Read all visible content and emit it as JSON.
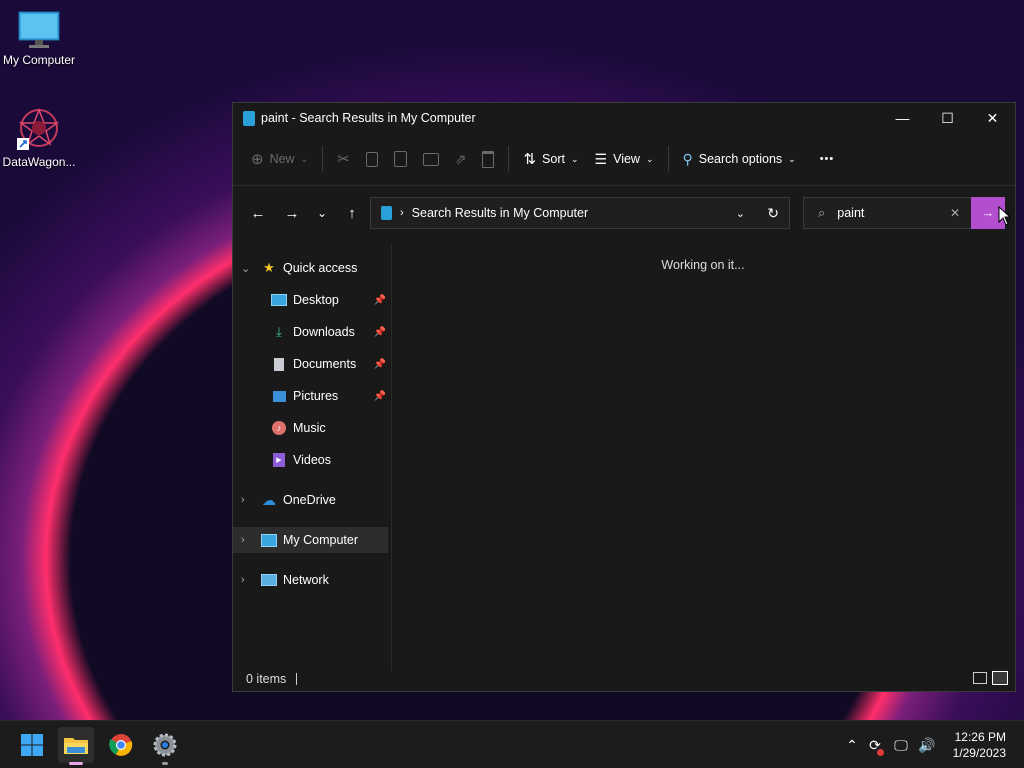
{
  "desktop": {
    "icons": [
      {
        "label": "My Computer",
        "icon": "monitor-icon"
      },
      {
        "label": "DataWagon...",
        "icon": "datawagon-shortcut-icon"
      }
    ]
  },
  "window": {
    "title": "paint - Search Results in My Computer",
    "controls": {
      "minimize": "—",
      "maximize": "☐",
      "close": "✕"
    }
  },
  "toolbar": {
    "new_label": "New",
    "sort_label": "Sort",
    "view_label": "View",
    "search_options_label": "Search options",
    "more_label": "•••"
  },
  "address_bar": {
    "path": "Search Results in My Computer"
  },
  "search": {
    "value": "paint"
  },
  "nav_pane": {
    "quick_access": "Quick access",
    "items": [
      {
        "label": "Desktop",
        "pinned": true
      },
      {
        "label": "Downloads",
        "pinned": true
      },
      {
        "label": "Documents",
        "pinned": true
      },
      {
        "label": "Pictures",
        "pinned": true
      },
      {
        "label": "Music",
        "pinned": false
      },
      {
        "label": "Videos",
        "pinned": false
      }
    ],
    "onedrive": "OneDrive",
    "my_computer": "My Computer",
    "network": "Network"
  },
  "content": {
    "status_message": "Working on it..."
  },
  "status_bar": {
    "item_count": "0 items"
  },
  "taskbar": {
    "clock_time": "12:26 PM",
    "clock_date": "1/29/2023"
  },
  "colors": {
    "accent_go_button": "#b34fcf",
    "window_bg": "#191919",
    "taskbar_bg": "#1c1c1c"
  }
}
